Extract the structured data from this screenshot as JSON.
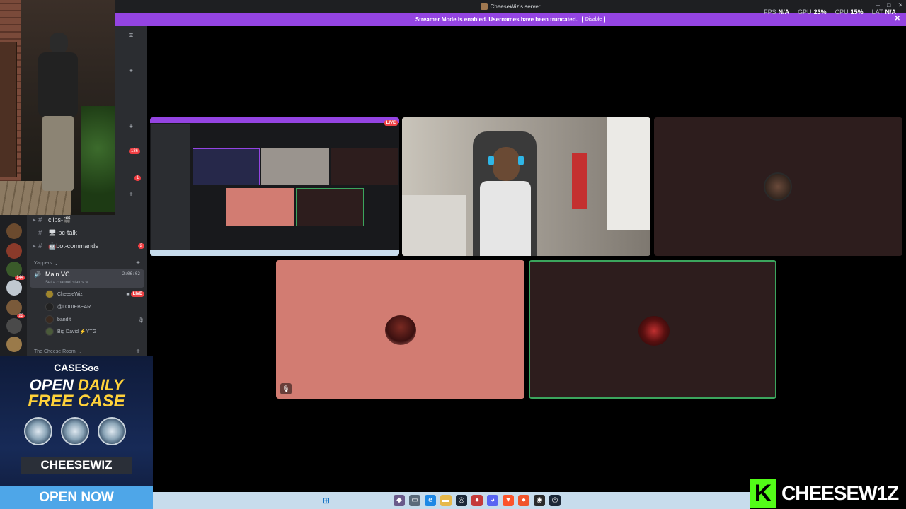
{
  "window": {
    "title": "CheeseWiz's server",
    "controls": [
      "–",
      "□",
      "✕"
    ]
  },
  "perf": {
    "fps_label": "FPS",
    "fps_value": "N/A",
    "gpu_label": "GPU",
    "gpu_value": "23%",
    "cpu_label": "CPU",
    "cpu_value": "15%",
    "lat_label": "LAT",
    "lat_value": "N/A"
  },
  "banner": {
    "text": "Streamer Mode is enabled. Usernames have been truncated.",
    "button": "Disable",
    "close": "✕"
  },
  "server_rail": {
    "badges": [
      "136",
      "1",
      "144",
      "22"
    ]
  },
  "sidebar": {
    "top_badges": [
      "136",
      "1"
    ],
    "channels": [
      {
        "name": "clips-🎬",
        "badge": ""
      },
      {
        "name": "🖥-pc-talk",
        "badge": ""
      },
      {
        "name": "🤖bot-commands",
        "badge": "2"
      }
    ],
    "category_yappers": "Yappers",
    "voice_channel": {
      "name": "Main VC",
      "time": "2:06:02",
      "status": "Set a channel status"
    },
    "members": [
      {
        "name": "CheeseWiz",
        "live": "LIVE"
      },
      {
        "name": "@LOUIEBEAR"
      },
      {
        "name": "bandit"
      },
      {
        "name": "Big David ⚡YTG"
      }
    ],
    "category_cheese": "The Cheese Room"
  },
  "ad": {
    "brand": "CASES",
    "brand_suffix": "GG",
    "line1_a": "OPEN",
    "line1_b": "DAILY",
    "line2": "FREE CASE",
    "code": "CHEESEWIZ",
    "cta": "OPEN NOW"
  },
  "stage": {
    "nested_live": "LIVE"
  },
  "watermark": {
    "letter": "K",
    "text": "CHEESEW1Z"
  },
  "colors": {
    "banner": "#9444e2",
    "kick_green": "#53fc18",
    "speaking_border": "#3ba55d",
    "live_red": "#ed4245"
  }
}
